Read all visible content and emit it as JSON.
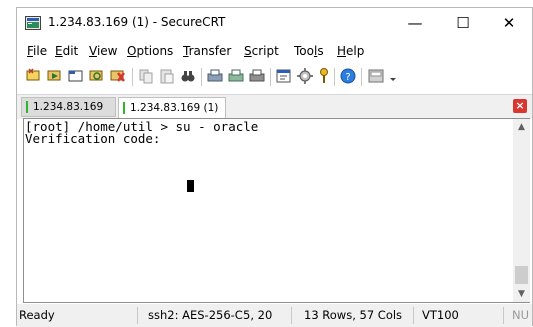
{
  "window": {
    "title": "1.234.83.169 (1) - SecureCRT",
    "minimize_glyph": "—",
    "maximize_glyph": "☐",
    "close_glyph": "✕"
  },
  "menu": [
    {
      "accel": "F",
      "rest": "ile"
    },
    {
      "accel": "E",
      "rest": "dit"
    },
    {
      "accel": "V",
      "rest": "iew"
    },
    {
      "accel": "O",
      "rest": "ptions"
    },
    {
      "accel": "T",
      "rest": "ransfer"
    },
    {
      "accel": "S",
      "rest": "cript"
    },
    {
      "pre": "Too",
      "accel": "l",
      "rest": "s"
    },
    {
      "accel": "H",
      "rest": "elp"
    }
  ],
  "toolbar_icons": [
    "connect-icon",
    "quick-connect-icon",
    "connect-tab-icon",
    "reconnect-icon",
    "disconnect-icon",
    "copy-icon",
    "paste-icon",
    "find-icon",
    "print-icon",
    "print-selection-icon",
    "print-setup-icon",
    "session-options-icon",
    "global-options-icon",
    "keymap-icon",
    "help-icon",
    "sftp-icon",
    "toolbar-overflow-icon"
  ],
  "tabs": {
    "inactive_label": "1.234.83.169",
    "active_label": "1.234.83.169 (1)",
    "close_glyph": "×",
    "status_color": "#2db52d"
  },
  "terminal": {
    "lines": [
      "[root] /home/util > su - oracle",
      "Verification code:"
    ]
  },
  "scrollbar": {
    "up": "▲",
    "down": "▼"
  },
  "status": {
    "ready": "Ready",
    "cipher": "ssh2: AES-256-C",
    "cursor_pos": "5, 20",
    "size": "13 Rows, 57 Cols",
    "emulation": "VT100",
    "num_lock": "NU"
  }
}
